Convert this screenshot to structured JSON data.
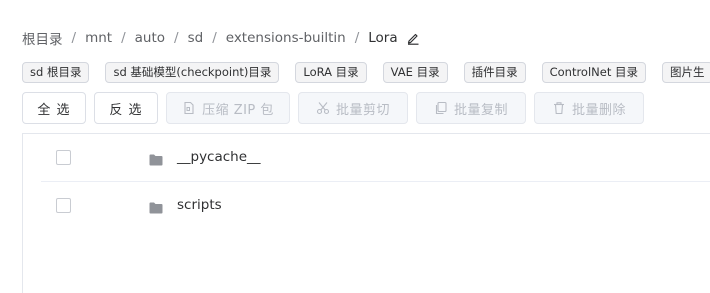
{
  "breadcrumb": {
    "items": [
      "根目录",
      "mnt",
      "auto",
      "sd",
      "extensions-builtin"
    ],
    "current": "Lora",
    "separator": "/"
  },
  "shortcuts": [
    "sd 根目录",
    "sd 基础模型(checkpoint)目录",
    "LoRA 目录",
    "VAE 目录",
    "插件目录",
    "ControlNet 目录",
    "图片生"
  ],
  "toolbar": {
    "select_all": "全 选",
    "invert": "反 选",
    "compress": "压缩 ZIP 包",
    "cut": "批量剪切",
    "copy": "批量复制",
    "delete": "批量删除"
  },
  "files": [
    {
      "name": "__pycache__",
      "type": "folder"
    },
    {
      "name": "scripts",
      "type": "folder"
    }
  ],
  "colors": {
    "folder": "#909399",
    "disabled_text": "#b8bcc4",
    "chip_bg": "#f4f4f5"
  },
  "icons": [
    "edit-icon",
    "zip-icon",
    "scissors-icon",
    "copy-icon",
    "trash-icon",
    "folder-icon"
  ]
}
